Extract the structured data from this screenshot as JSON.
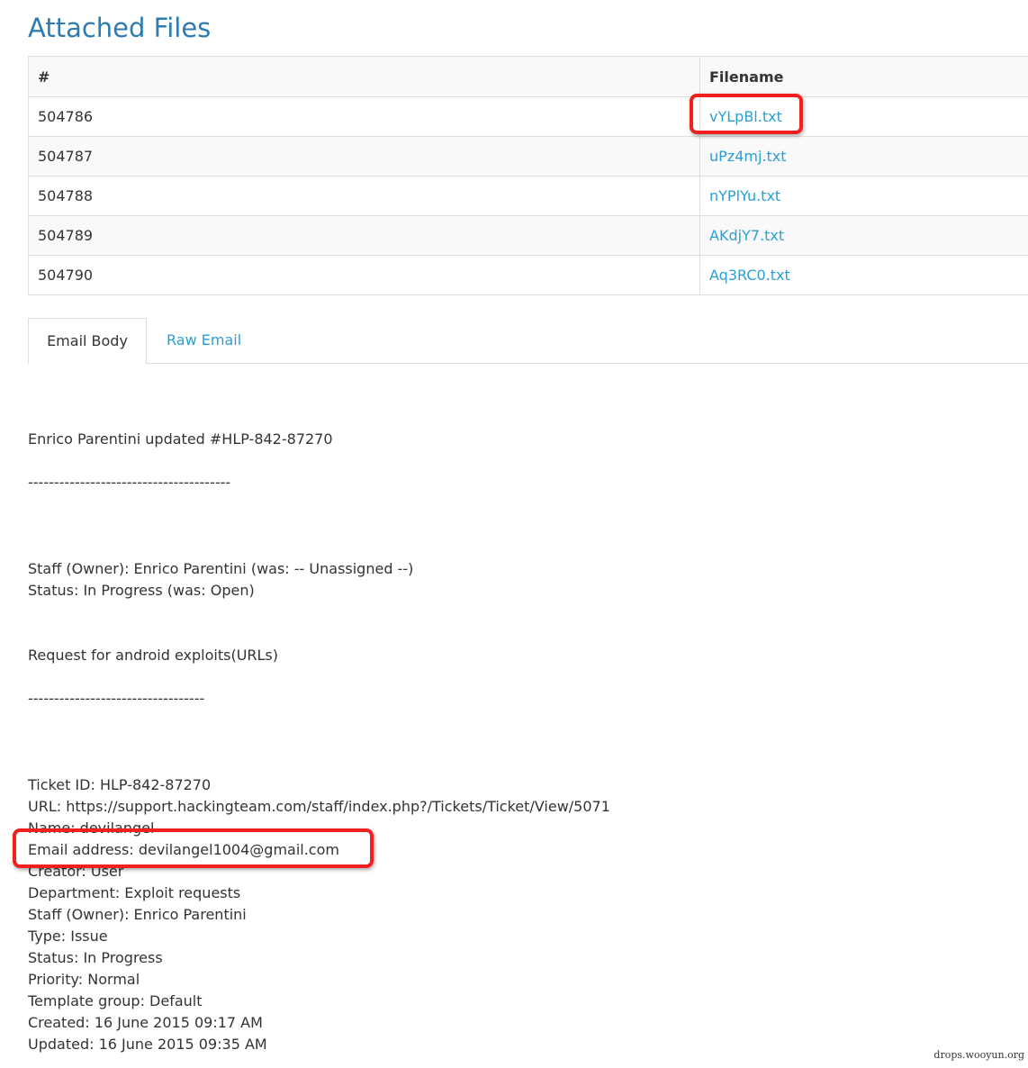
{
  "title": "Attached Files",
  "table": {
    "headers": [
      "#",
      "Filename"
    ],
    "rows": [
      [
        "504786",
        "vYLpBl.txt"
      ],
      [
        "504787",
        "uPz4mj.txt"
      ],
      [
        "504788",
        "nYPlYu.txt"
      ],
      [
        "504789",
        "AKdjY7.txt"
      ],
      [
        "504790",
        "Aq3RC0.txt"
      ]
    ]
  },
  "tabs": [
    "Email Body",
    "Raw Email"
  ],
  "body": {
    "l1": "Enrico Parentini updated #HLP-842-87270",
    "d1": "---------------------------------------",
    "l2": "Staff (Owner): Enrico Parentini (was: -- Unassigned --)",
    "l3": "Status: In Progress (was: Open)",
    "l4": "Request for android exploits(URLs)",
    "d2": "----------------------------------",
    "details": [
      "Ticket ID: HLP-842-87270",
      "URL: https://support.hackingteam.com/staff/index.php?/Tickets/Ticket/View/5071",
      "Name: devilangel",
      "Email address: devilangel1004@gmail.com",
      "Creator: User",
      "Department: Exploit requests",
      "Staff (Owner): Enrico Parentini",
      "Type: Issue",
      "Status: In Progress",
      "Priority: Normal",
      "Template group: Default",
      "Created: 16 June 2015 09:17 AM",
      "Updated: 16 June 2015 09:35 AM"
    ]
  },
  "watermark": "drops.wooyun.org",
  "colors": {
    "heading": "#2e7bb0",
    "link": "#2a9fd6",
    "highlight": "#f02020"
  }
}
